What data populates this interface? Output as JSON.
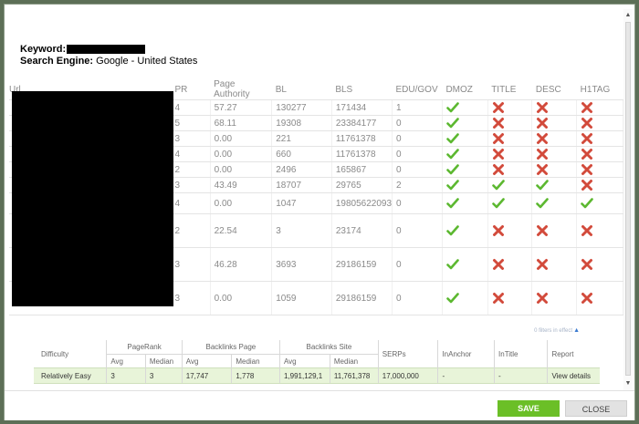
{
  "keyword": {
    "label": "Keyword:"
  },
  "search_engine": {
    "label": "Search Engine:",
    "value": "Google - United States"
  },
  "results": {
    "columns": [
      "Url",
      "PR",
      "Page Authority",
      "BL",
      "BLS",
      "EDU/GOV",
      "DMOZ",
      "TITLE",
      "DESC",
      "H1TAG"
    ],
    "rows": [
      {
        "pr": "4",
        "pa": "57.27",
        "bl": "130277",
        "bls": "171434",
        "edu": "1",
        "dmoz": "check",
        "title": "cross",
        "desc": "cross",
        "h1": "cross"
      },
      {
        "pr": "5",
        "pa": "68.11",
        "bl": "19308",
        "bls": "23384177",
        "edu": "0",
        "dmoz": "check",
        "title": "cross",
        "desc": "cross",
        "h1": "cross"
      },
      {
        "pr": "3",
        "pa": "0.00",
        "bl": "221",
        "bls": "11761378",
        "edu": "0",
        "dmoz": "check",
        "title": "cross",
        "desc": "cross",
        "h1": "cross"
      },
      {
        "pr": "4",
        "pa": "0.00",
        "bl": "660",
        "bls": "11761378",
        "edu": "0",
        "dmoz": "check",
        "title": "cross",
        "desc": "cross",
        "h1": "cross"
      },
      {
        "pr": "2",
        "pa": "0.00",
        "bl": "2496",
        "bls": "165867",
        "edu": "0",
        "dmoz": "check",
        "title": "cross",
        "desc": "cross",
        "h1": "cross"
      },
      {
        "pr": "3",
        "pa": "43.49",
        "bl": "18707",
        "bls": "29765",
        "edu": "2",
        "dmoz": "check",
        "title": "check",
        "desc": "check",
        "h1": "cross"
      },
      {
        "pr": "4",
        "pa": "0.00",
        "bl": "1047",
        "bls": "19805622093",
        "edu": "0",
        "dmoz": "check",
        "title": "check",
        "desc": "check",
        "h1": "check"
      },
      {
        "pr": "2",
        "pa": "22.54",
        "bl": "3",
        "bls": "23174",
        "edu": "0",
        "dmoz": "check",
        "title": "cross",
        "desc": "cross",
        "h1": "cross"
      },
      {
        "pr": "3",
        "pa": "46.28",
        "bl": "3693",
        "bls": "29186159",
        "edu": "0",
        "dmoz": "check",
        "title": "cross",
        "desc": "cross",
        "h1": "cross"
      },
      {
        "pr": "3",
        "pa": "0.00",
        "bl": "1059",
        "bls": "29186159",
        "edu": "0",
        "dmoz": "check",
        "title": "cross",
        "desc": "cross",
        "h1": "cross"
      }
    ]
  },
  "filters_note": "0 filters in effect",
  "summary": {
    "headers": {
      "difficulty": "Difficulty",
      "pagerank": "PageRank",
      "backlinks_page": "Backlinks Page",
      "backlinks_site": "Backlinks Site",
      "serps": "SERPs",
      "inanchor": "InAnchor",
      "intitle": "InTitle",
      "report": "Report",
      "avg": "Avg",
      "median": "Median"
    },
    "row": {
      "difficulty": "Relatively Easy",
      "pr_avg": "3",
      "pr_median": "3",
      "blp_avg": "17,747",
      "blp_median": "1,778",
      "bls_avg": "1,991,129,1",
      "bls_median": "11,761,378",
      "serps": "17,000,000",
      "inanchor": "-",
      "intitle": "-",
      "report": "View details"
    }
  },
  "buttons": {
    "save": "SAVE",
    "close": "CLOSE"
  },
  "colors": {
    "check": "#5cb830",
    "cross": "#d24a3b",
    "save_bg": "#6bbf27",
    "summary_row_bg": "#e8f4d9"
  },
  "icons": {
    "check": "check-icon",
    "cross": "cross-icon"
  }
}
